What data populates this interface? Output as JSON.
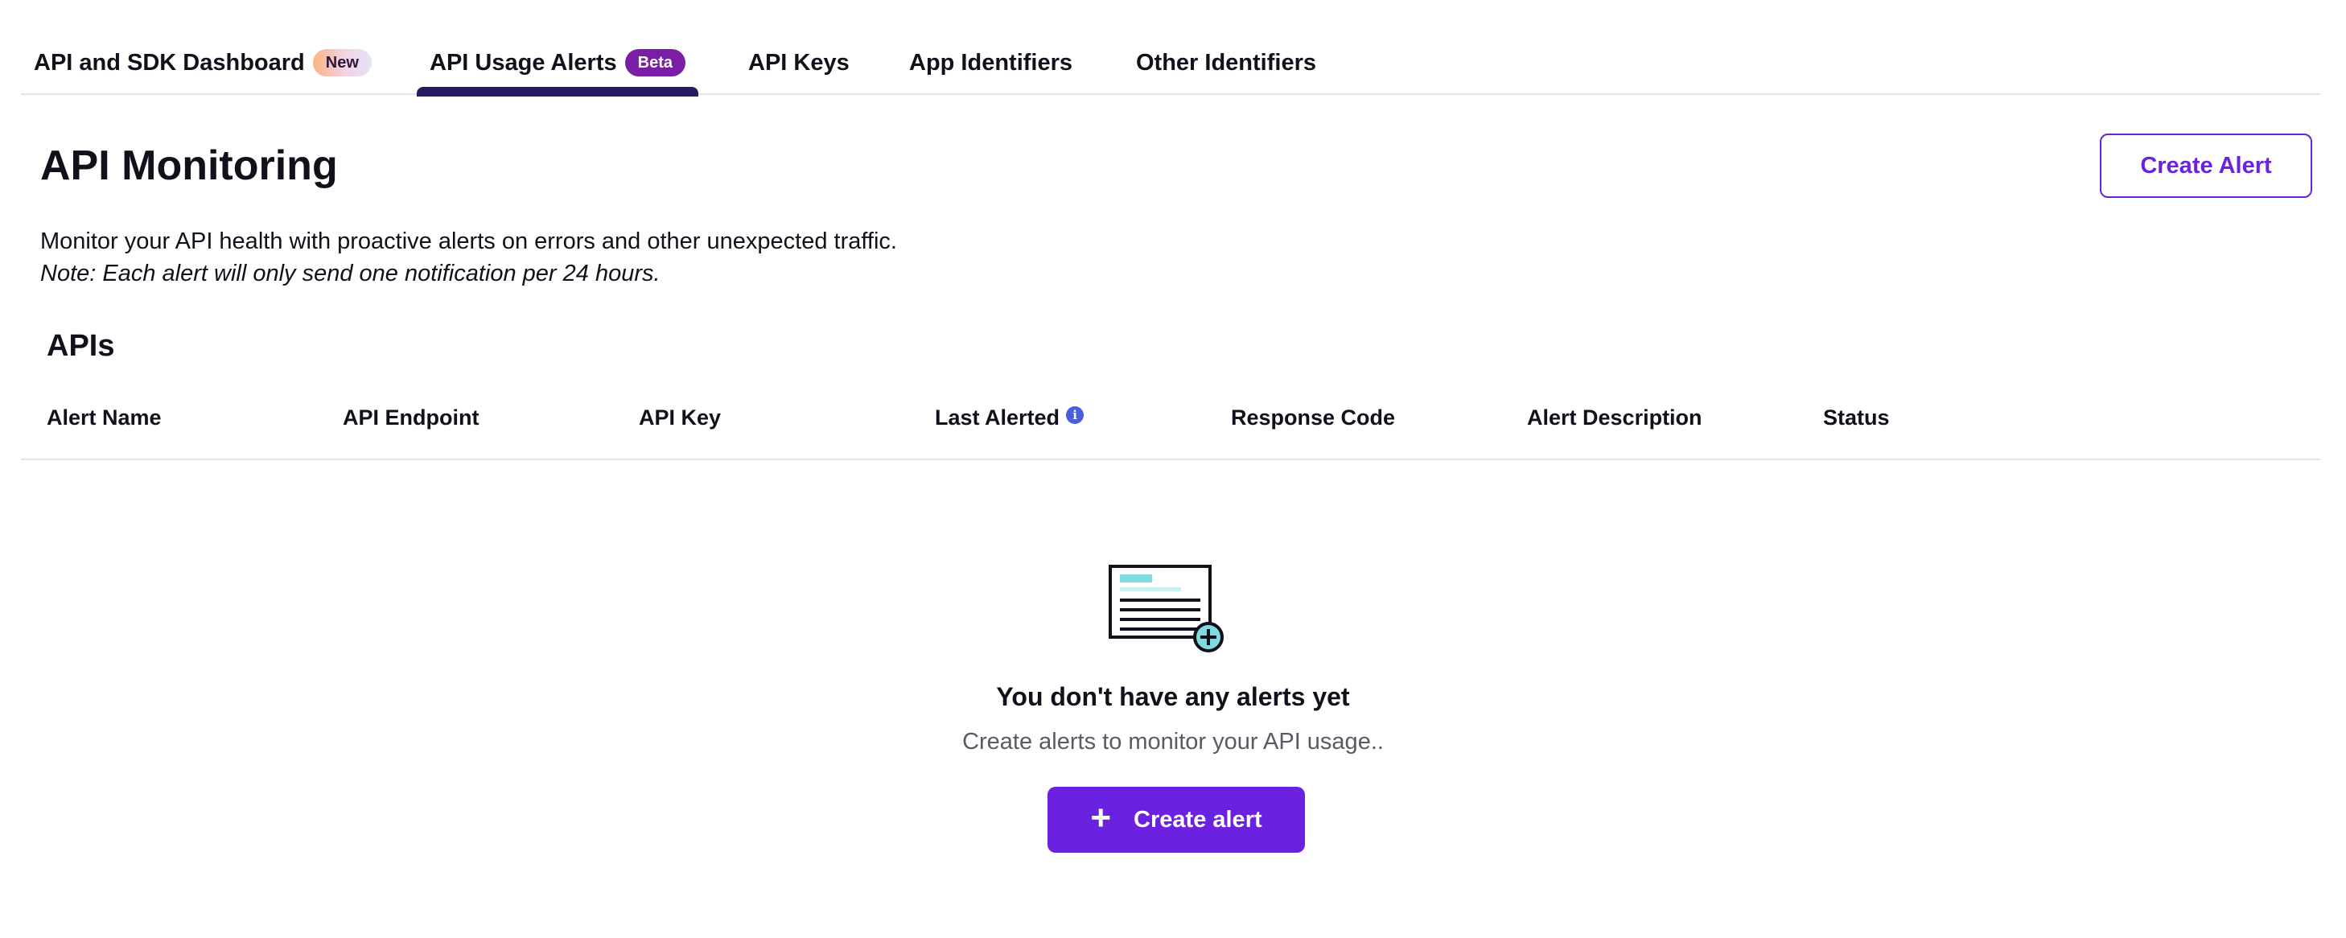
{
  "tabs": [
    {
      "label": "API and SDK Dashboard",
      "badge": "New",
      "active": false
    },
    {
      "label": "API Usage Alerts",
      "badge": "Beta",
      "active": true
    },
    {
      "label": "API Keys",
      "active": false
    },
    {
      "label": "App Identifiers",
      "active": false
    },
    {
      "label": "Other Identifiers",
      "active": false
    }
  ],
  "header": {
    "title": "API Monitoring",
    "create_button": "Create Alert",
    "description": "Monitor your API health with proactive alerts on errors and other unexpected traffic.",
    "note": "Note: Each alert will only send one notification per 24 hours."
  },
  "apis": {
    "title": "APIs",
    "columns": [
      "Alert Name",
      "API Endpoint",
      "API Key",
      "Last Alerted",
      "Response Code",
      "Alert Description",
      "Status"
    ],
    "info_icon_glyph": "i"
  },
  "empty_state": {
    "title": "You don't have any alerts yet",
    "subtitle": "Create alerts to monitor your API usage..",
    "button": "Create alert",
    "button_icon": "+"
  },
  "colors": {
    "primary": "#6a22e0",
    "active_tab_underline": "#2a1a5e",
    "beta_badge": "#7a1ea8",
    "info_icon": "#4a5de0",
    "illustration_accent": "#7fdbe0"
  }
}
